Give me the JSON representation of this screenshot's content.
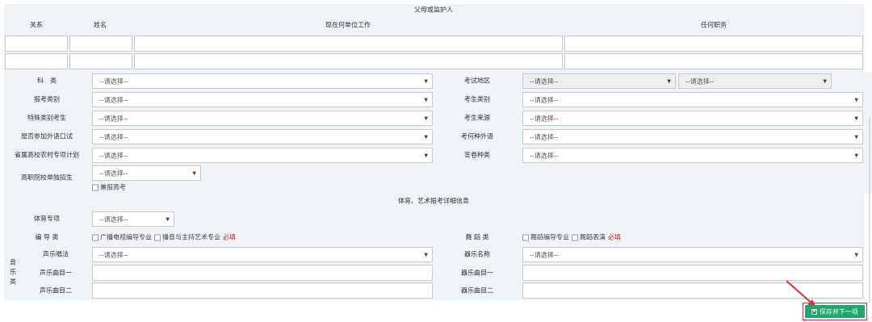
{
  "parents": {
    "title": "父母或监护人",
    "headers": [
      "关系",
      "姓名",
      "现在何单位工作",
      "任何职务"
    ]
  },
  "fields": {
    "subject": "科　类",
    "exam_area": "考试地区",
    "apply_type": "报考类别",
    "candidate_type": "考生类别",
    "special_type": "特殊类别考生",
    "candidate_source": "考生来源",
    "foreign_oral": "是否参加外语口试",
    "foreign_lang": "考何种外语",
    "rural_plan": "省属高校农村专项计划",
    "answer_lang": "答卷种类",
    "vocational": "高职院校单独招生",
    "also_apply": "兼报高考"
  },
  "placeholder": "--请选择--",
  "art_section": {
    "title": "体育、艺术报考详细信息",
    "sports": "体育专项",
    "director": "编 导 类",
    "director_opt1": "广播电视编导专业",
    "director_opt2": "播音与主持艺术专业",
    "required": "必填",
    "dance": "舞 蹈 类",
    "dance_opt1": "舞蹈编导专业",
    "dance_opt2": "舞蹈表演",
    "music_group": [
      "音",
      "乐",
      "类"
    ],
    "vocal_method": "声乐唱法",
    "instrument_name": "器乐名称",
    "vocal_song1": "声乐曲目一",
    "instrument_song1": "器乐曲目一",
    "vocal_song2": "声乐曲目二",
    "instrument_song2": "器乐曲目二"
  },
  "buttons": {
    "save_next": "保存并下一项"
  },
  "colors": {
    "band": "#eef3f8",
    "border": "#c8ccd2",
    "button": "#1aa86e",
    "required": "#e02020",
    "arrow": "#e03030"
  }
}
